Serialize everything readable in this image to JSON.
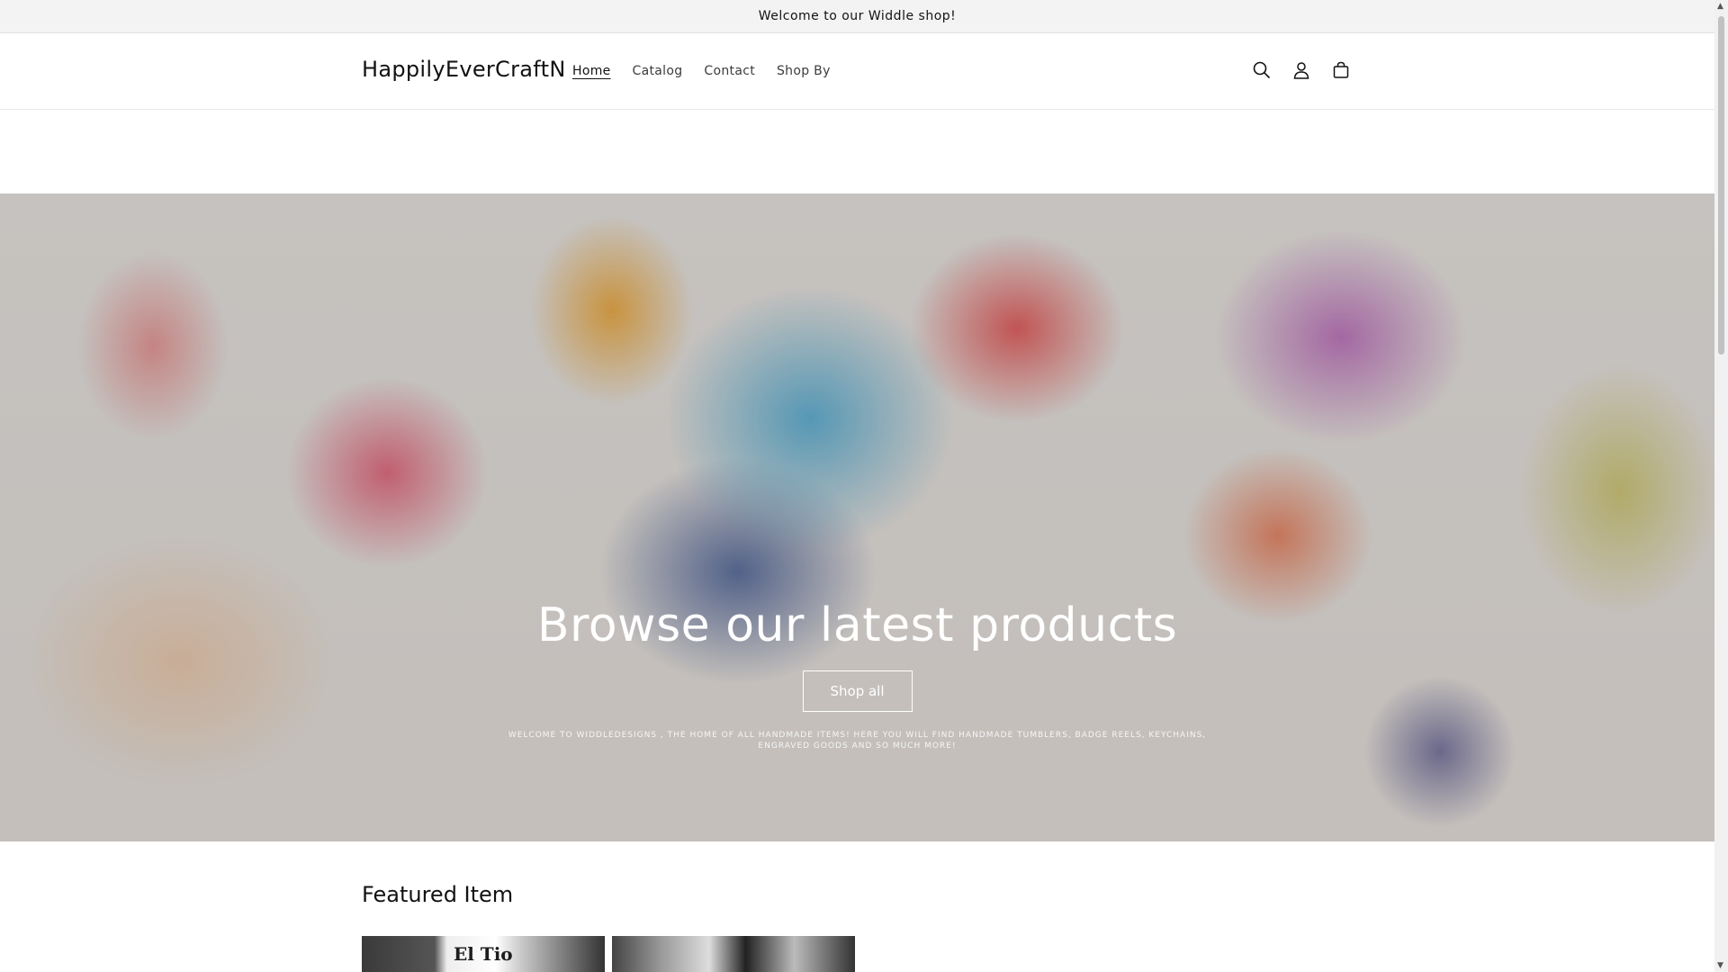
{
  "announcement": {
    "text": "Welcome to our Widdle shop!"
  },
  "header": {
    "logo": "HappilyEverCraftN",
    "nav": [
      {
        "label": "Home",
        "active": true
      },
      {
        "label": "Catalog",
        "active": false
      },
      {
        "label": "Contact",
        "active": false
      },
      {
        "label": "Shop By",
        "active": false
      }
    ],
    "icons": [
      "search-icon",
      "account-icon",
      "cart-icon"
    ]
  },
  "hero": {
    "title": "Browse our latest products",
    "button_label": "Shop all",
    "text": "Welcome to WiddleDesigns , the home of all handmade items! Here you will find handmade tumblers, badge reels, keychains, engraved goods and so much more!"
  },
  "featured": {
    "heading": "Featured Item",
    "cards": [
      {
        "image_text": "El Tio"
      },
      {
        "image_text": ""
      }
    ]
  },
  "colors": {
    "text": "#121212",
    "announcement_bg": "#f3f3f3",
    "hero_overlay": "rgba(0,0,0,0.18)"
  }
}
